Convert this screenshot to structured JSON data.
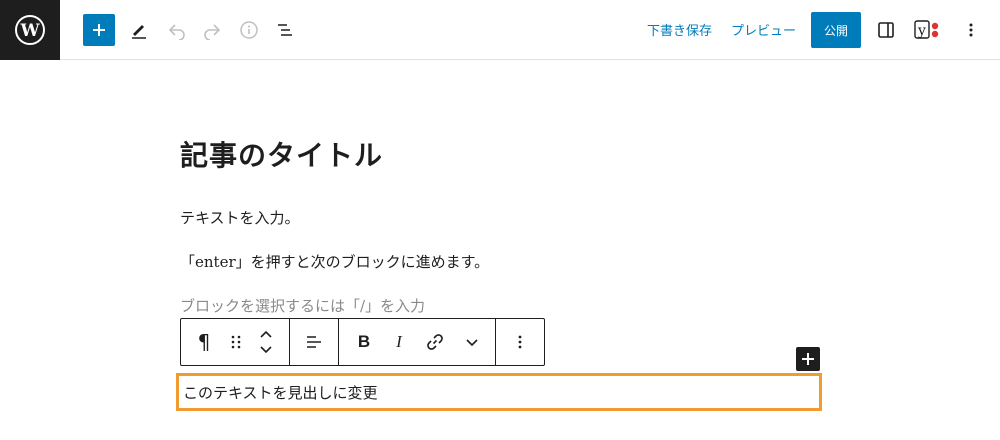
{
  "toolbar": {
    "save_draft": "下書き保存",
    "preview": "プレビュー",
    "publish": "公開",
    "yoast_letter": "y"
  },
  "icons": {
    "logo": "wordpress-icon",
    "add": "plus-icon",
    "edit": "pencil-icon",
    "undo": "undo-icon",
    "redo": "redo-icon",
    "info": "info-icon",
    "list_view": "list-view-icon",
    "settings": "sidebar-icon",
    "yoast": "yoast-icon",
    "options": "more-vertical-icon"
  },
  "colors": {
    "accent": "#007cba",
    "highlight": "#f19c31",
    "dark": "#1e1e1e",
    "placeholder": "#8a8a8a",
    "yoast_dot": "#dc3232"
  },
  "editor": {
    "title": "記事のタイトル",
    "paragraphs": [
      "テキストを入力。",
      "「enter」を押すと次のブロックに進めます。"
    ],
    "placeholder": "ブロックを選択するには「/」を入力",
    "selected_block_text": "このテキストを見出しに変更"
  },
  "block_toolbar": {
    "paragraph_symbol": "¶",
    "bold": "B",
    "italic": "I"
  }
}
